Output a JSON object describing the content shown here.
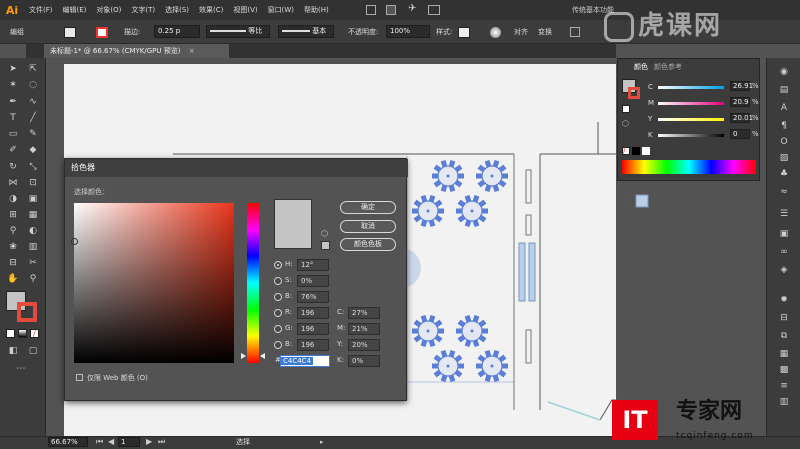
{
  "app": {
    "logo": "Ai",
    "workspace": "传统基本功能"
  },
  "menu": [
    "文件(F)",
    "编辑(E)",
    "对象(O)",
    "文字(T)",
    "选择(S)",
    "效果(C)",
    "视图(V)",
    "窗口(W)",
    "帮助(H)"
  ],
  "control_bar": {
    "selection_label": "编组",
    "stroke_label": "描边:",
    "stroke_value": "0.25 p",
    "profile_label": "等比",
    "brush_label": "基本",
    "opacity_label": "不透明度:",
    "opacity_value": "100%",
    "style_label": "样式:",
    "align_label": "对齐",
    "transform_label": "变换"
  },
  "document_tab": "未标题-1* @ 66.67% (CMYK/GPU 预览)",
  "color_panel": {
    "tab_color": "颜色",
    "tab_guide": "颜色参考",
    "channels": [
      {
        "label": "C",
        "value": "26.91",
        "unit": "%"
      },
      {
        "label": "M",
        "value": "20.9",
        "unit": "%"
      },
      {
        "label": "Y",
        "value": "20.01",
        "unit": "%"
      },
      {
        "label": "K",
        "value": "0",
        "unit": "%"
      }
    ]
  },
  "picker": {
    "title": "拾色器",
    "select_color_label": "选择颜色：",
    "buttons": {
      "ok": "确定",
      "cancel": "取消",
      "swatches": "颜色色板"
    },
    "hsb": [
      {
        "label": "H:",
        "value": "12°"
      },
      {
        "label": "S:",
        "value": "0%"
      },
      {
        "label": "B:",
        "value": "76%"
      }
    ],
    "rgb": [
      {
        "label": "R:",
        "value": "196"
      },
      {
        "label": "G:",
        "value": "196"
      },
      {
        "label": "B:",
        "value": "196"
      }
    ],
    "cmyk": [
      {
        "label": "C:",
        "value": "27%"
      },
      {
        "label": "M:",
        "value": "21%"
      },
      {
        "label": "Y:",
        "value": "20%"
      },
      {
        "label": "K:",
        "value": "0%"
      }
    ],
    "hex_label": "#",
    "hex_value": "C4C4C4",
    "web_only_label": "仅限 Web 颜色 (O)",
    "current_color": "#c4c4c4"
  },
  "status_bar": {
    "zoom": "66.67%",
    "page": "1",
    "mode": "选择"
  },
  "watermark": {
    "top_text": "虎课网",
    "brand_mark": "IT",
    "brand_name": "专家网",
    "brand_url": "tcqinfeng.com"
  },
  "colors": {
    "accent_table": "#5b7ed8",
    "fill_swatch": "#c4c4c4",
    "window_blue": "#b9cfe6",
    "brand_red": "#e60012"
  }
}
